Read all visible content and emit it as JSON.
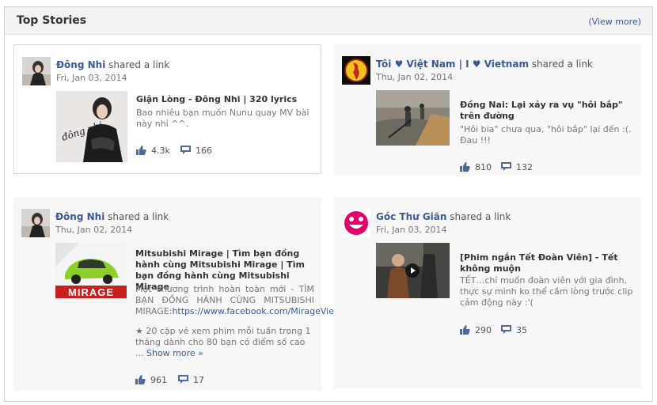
{
  "header": {
    "title": "Top Stories",
    "view_more": "(View more)"
  },
  "verb": "shared a link",
  "colors": {
    "link": "#3b5998",
    "icon": "#4b6a9b"
  },
  "posts": [
    {
      "author": "Đông Nhi",
      "date": "Fri, Jan 03, 2014",
      "title": "Giận Lòng - Đông Nhi | 320 lyrics",
      "desc": "Bao nhiêu bạn muốn Nunu quay MV bài này nhỉ ^^.",
      "likes": "4.3k",
      "comments": "166",
      "thumb_text": "đông nhi"
    },
    {
      "author": "Tôi ♥ Việt Nam | I ♥ Vietnam",
      "date": "Thu, Jan 02, 2014",
      "title": "Đồng Nai: Lại xảy ra vụ \"hôi bắp\" trên đường",
      "desc": "\"Hôi bia\" chưa qua, \"hôi bắp\" lại đến :(. Đau !!!",
      "likes": "810",
      "comments": "132"
    },
    {
      "author": "Đông Nhi",
      "date": "Thu, Jan 02, 2014",
      "title": "Mitsubishi Mirage | Tìm bạn đồng hành cùng Mitsubishi Mirage | Tìm bạn đồng hành cùng Mitsubishi Mirage",
      "desc": "Một chương trình hoàn toàn mới - TÌM BẠN ĐỒNG HÀNH CÙNG MITSUBISHI MIRAGE:",
      "desc_link": "https://www.facebook.com/MirageVie",
      "extra": "★ 20 cặp vé xem phim mỗi tuần trong 1 tháng dành cho 80 bạn có điểm số cao ... ",
      "show_more": "Show more »",
      "likes": "961",
      "comments": "17",
      "thumb_text": "MIRAGE"
    },
    {
      "author": "Góc Thư Giãn",
      "date": "Fri, Jan 03, 2014",
      "title": "[Phim ngắn Tết Đoàn Viên] - Tết không muộn",
      "desc": "TẾT…chỉ muốn đoàn viên với gia đình, thực sự mình ko thể cầm lòng trước clip cảm động này :'(",
      "likes": "290",
      "comments": "35"
    }
  ]
}
